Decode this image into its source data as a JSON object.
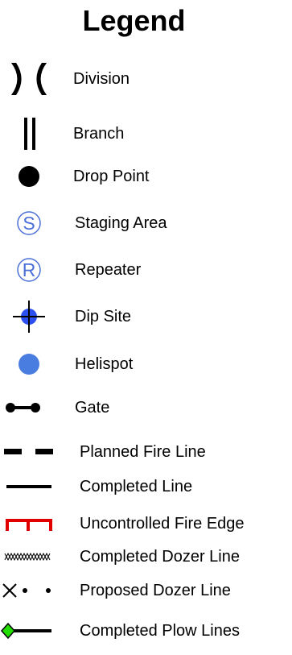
{
  "legend": {
    "title": "Legend",
    "items": [
      {
        "label": "Division",
        "icon": "division-icon"
      },
      {
        "label": "Branch",
        "icon": "branch-icon"
      },
      {
        "label": "Drop Point",
        "icon": "drop-point-icon"
      },
      {
        "label": "Staging Area",
        "icon": "staging-area-icon"
      },
      {
        "label": "Repeater",
        "icon": "repeater-icon"
      },
      {
        "label": "Dip Site",
        "icon": "dip-site-icon"
      },
      {
        "label": "Helispot",
        "icon": "helispot-icon"
      },
      {
        "label": "Gate",
        "icon": "gate-icon"
      },
      {
        "label": "Planned Fire Line",
        "icon": "planned-fire-line-icon"
      },
      {
        "label": "Completed Line",
        "icon": "completed-line-icon"
      },
      {
        "label": "Uncontrolled Fire Edge",
        "icon": "uncontrolled-fire-edge-icon"
      },
      {
        "label": "Completed Dozer Line",
        "icon": "completed-dozer-line-icon"
      },
      {
        "label": "Proposed Dozer Line",
        "icon": "proposed-dozer-line-icon"
      },
      {
        "label": "Completed Plow Lines",
        "icon": "completed-plow-lines-icon"
      }
    ]
  },
  "colors": {
    "symbol_blue": "#4a6fd8",
    "helispot_blue": "#4a7de0",
    "fire_edge_red": "#e00000",
    "plow_green": "#22dd00"
  }
}
